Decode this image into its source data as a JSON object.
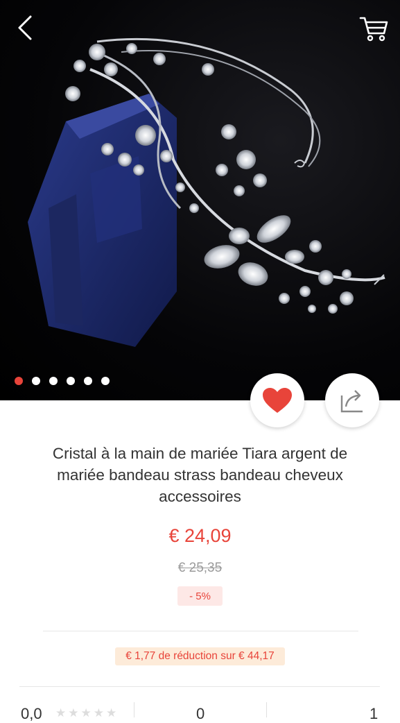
{
  "header": {
    "back_icon": "chevron-left-icon",
    "cart_icon": "shopping-cart-icon"
  },
  "gallery": {
    "image_count": 6,
    "active_index": 0,
    "accent_color": "#e8443a"
  },
  "actions": {
    "favorite_icon": "heart-icon",
    "share_icon": "share-icon"
  },
  "product": {
    "title": "Cristal à la main de mariée Tiara argent de mariée bandeau strass bandeau cheveux accessoires",
    "price": "€ 24,09",
    "old_price": "€ 25,35",
    "discount": "- 5%",
    "promo": "€ 1,77 de réduction sur € 44,17"
  },
  "stats": {
    "rating": "0,0",
    "middle": "0",
    "right": "1"
  }
}
